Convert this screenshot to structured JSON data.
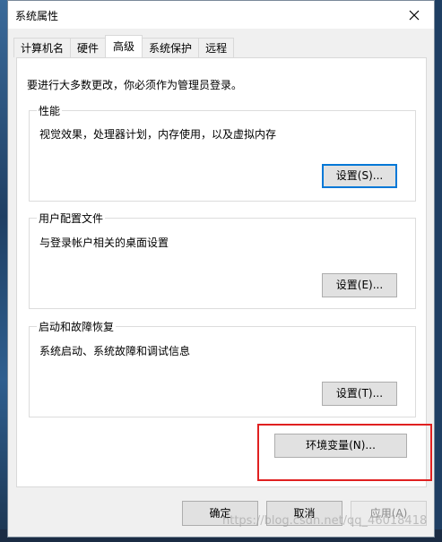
{
  "window": {
    "title": "系统属性"
  },
  "tabs": [
    {
      "label": "计算机名",
      "active": false
    },
    {
      "label": "硬件",
      "active": false
    },
    {
      "label": "高级",
      "active": true
    },
    {
      "label": "系统保护",
      "active": false
    },
    {
      "label": "远程",
      "active": false
    }
  ],
  "notice": "要进行大多数更改，你必须作为管理员登录。",
  "performance": {
    "title": "性能",
    "description": "视觉效果，处理器计划，内存使用，以及虚拟内存",
    "button": "设置(S)..."
  },
  "user_profiles": {
    "title": "用户配置文件",
    "description": "与登录帐户相关的桌面设置",
    "button": "设置(E)..."
  },
  "startup_recovery": {
    "title": "启动和故障恢复",
    "description": "系统启动、系统故障和调试信息",
    "button": "设置(T)..."
  },
  "env_button": "环境变量(N)...",
  "footer": {
    "ok": "确定",
    "cancel": "取消",
    "apply": "应用(A)"
  },
  "watermark": "https://blog.csdn.net/qq_46018418",
  "colors": {
    "highlight": "#e02020",
    "focus": "#0078d7"
  }
}
